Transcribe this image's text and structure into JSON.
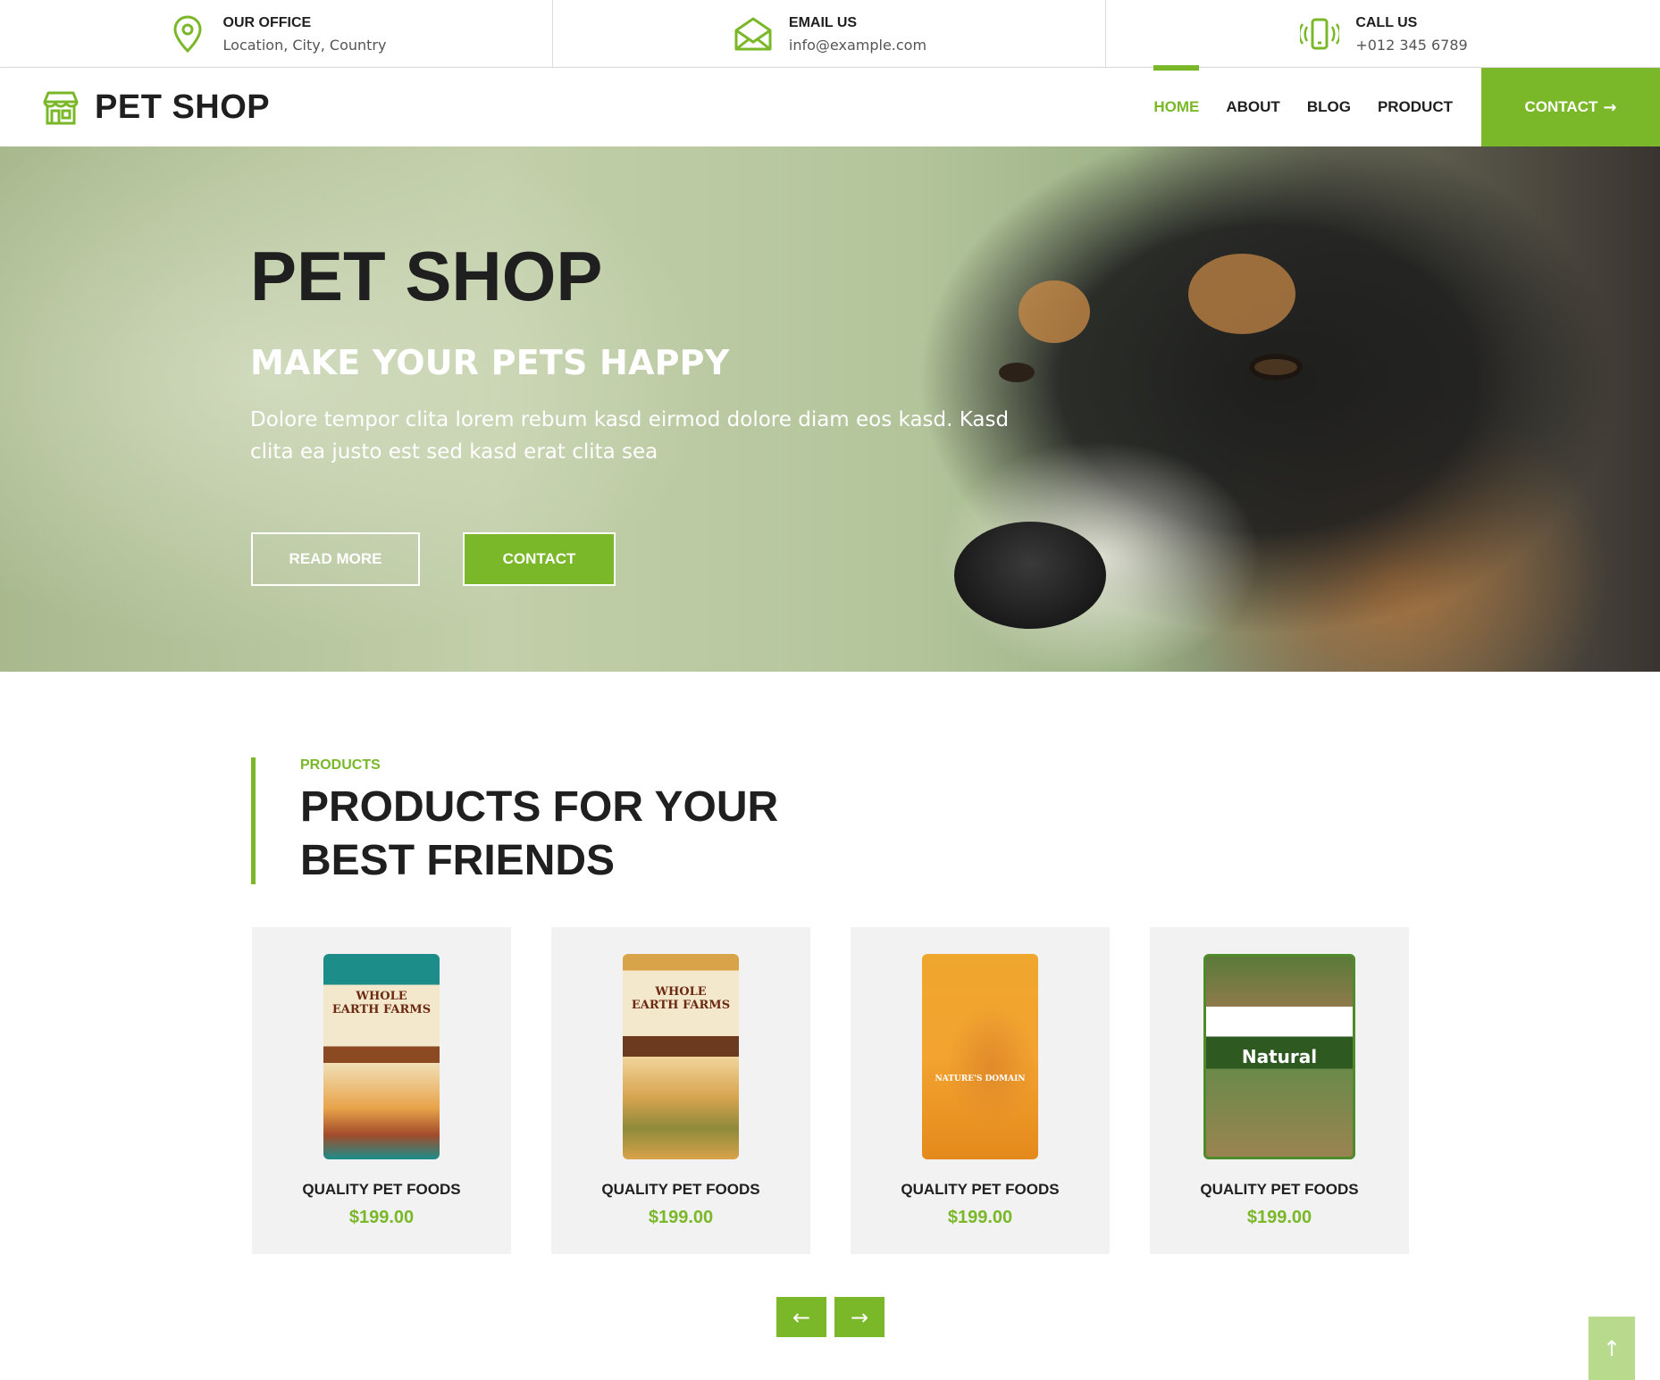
{
  "topbar": {
    "office": {
      "title": "OUR OFFICE",
      "value": "Location, City, Country",
      "icon": "map-pin-icon"
    },
    "email": {
      "title": "EMAIL US",
      "value": "info@example.com",
      "icon": "envelope-icon"
    },
    "phone": {
      "title": "CALL US",
      "value": "+012 345 6789",
      "icon": "phone-vibrate-icon"
    }
  },
  "nav": {
    "brand": "PET SHOP",
    "brand_icon": "shop-icon",
    "items": [
      {
        "label": "HOME",
        "active": true
      },
      {
        "label": "ABOUT",
        "active": false
      },
      {
        "label": "BLOG",
        "active": false
      },
      {
        "label": "PRODUCT",
        "active": false
      }
    ],
    "cta": "CONTACT",
    "cta_arrow": "→"
  },
  "hero": {
    "title": "PET SHOP",
    "subtitle": "MAKE YOUR PETS HAPPY",
    "text": "Dolore tempor clita lorem rebum kasd eirmod dolore diam eos kasd. Kasd clita ea justo est sed kasd erat clita sea",
    "btn_read": "READ MORE",
    "btn_contact": "CONTACT"
  },
  "products": {
    "kicker": "PRODUCTS",
    "title": "PRODUCTS FOR YOUR BEST FRIENDS",
    "items": [
      {
        "name": "QUALITY PET FOODS",
        "price": "$199.00",
        "pack_label": "WHOLE EARTH FARMS"
      },
      {
        "name": "QUALITY PET FOODS",
        "price": "$199.00",
        "pack_label": "WHOLE EARTH FARMS"
      },
      {
        "name": "QUALITY PET FOODS",
        "price": "$199.00",
        "pack_label": "NATURE'S DOMAIN"
      },
      {
        "name": "QUALITY PET FOODS",
        "price": "$199.00",
        "pack_label": "Natural"
      }
    ],
    "prev": "←",
    "next": "→"
  },
  "back_to_top": "↑",
  "colors": {
    "accent": "#7ab829",
    "text": "#1f1f1f",
    "card_bg": "#f2f2f2",
    "back_to_top": "#b7da8d"
  }
}
